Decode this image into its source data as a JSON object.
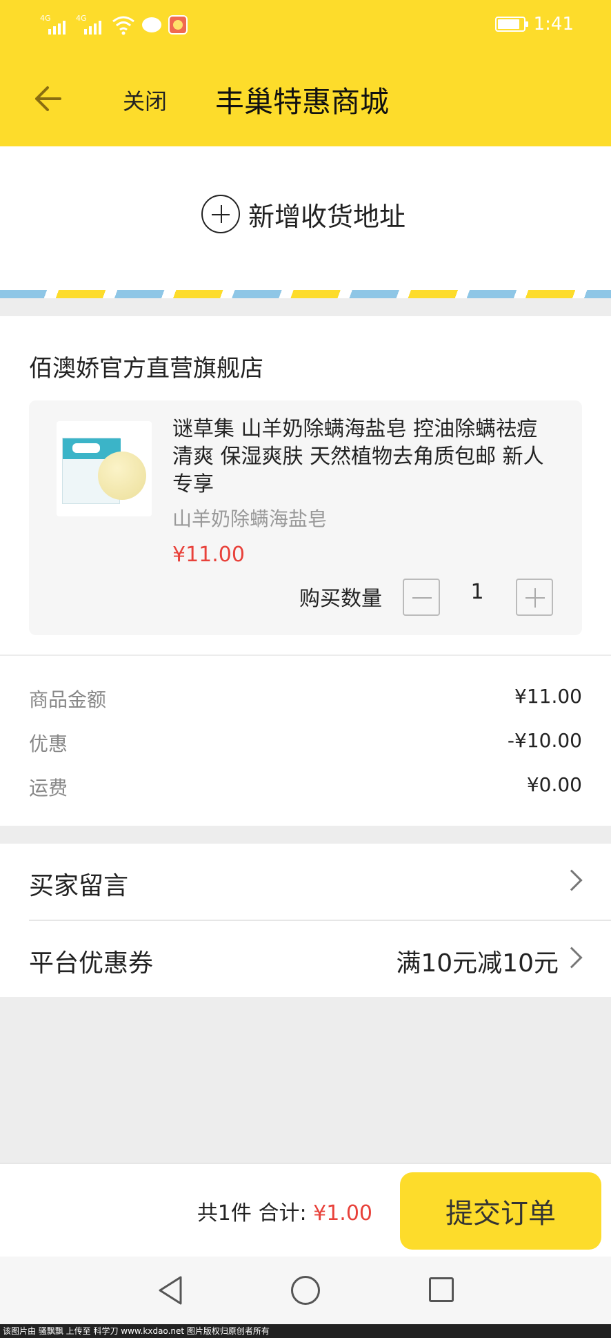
{
  "status_bar": {
    "network_labels": [
      "4G",
      "4G"
    ],
    "battery_level": 0.85,
    "time": "1:41"
  },
  "header": {
    "back_icon": "arrow-left-icon",
    "close_label": "关闭",
    "title": "丰巢特惠商城"
  },
  "address": {
    "icon": "plus-circle-icon",
    "add_label": "新增收货地址"
  },
  "store": {
    "name": "佰澳娇官方直营旗舰店",
    "product": {
      "title": "谜草集 山羊奶除螨海盐皂 控油除螨祛痘清爽 保湿爽肤 天然植物去角质包邮 新人专享",
      "variant": "山羊奶除螨海盐皂",
      "price": "¥11.00",
      "quantity_label": "购买数量",
      "quantity": "1"
    }
  },
  "summary": {
    "rows": [
      {
        "label": "商品金额",
        "value": "¥11.00"
      },
      {
        "label": "优惠",
        "value": "-¥10.00"
      },
      {
        "label": "运费",
        "value": "¥0.00"
      }
    ]
  },
  "options": {
    "message_label": "买家留言",
    "coupon_label": "平台优惠券",
    "coupon_value": "满10元减10元"
  },
  "bottom_bar": {
    "count_text": "共1件",
    "total_label": "合计:",
    "total_amount": "¥1.00",
    "submit_label": "提交订单"
  },
  "watermark": "该图片由 骚飘飘 上传至 科学刀 www.kxdao.net 图片版权归原创者所有",
  "colors": {
    "brand_yellow": "#fddc2b",
    "price_red": "#e8413a",
    "stripe_blue": "#8ec6e6"
  }
}
